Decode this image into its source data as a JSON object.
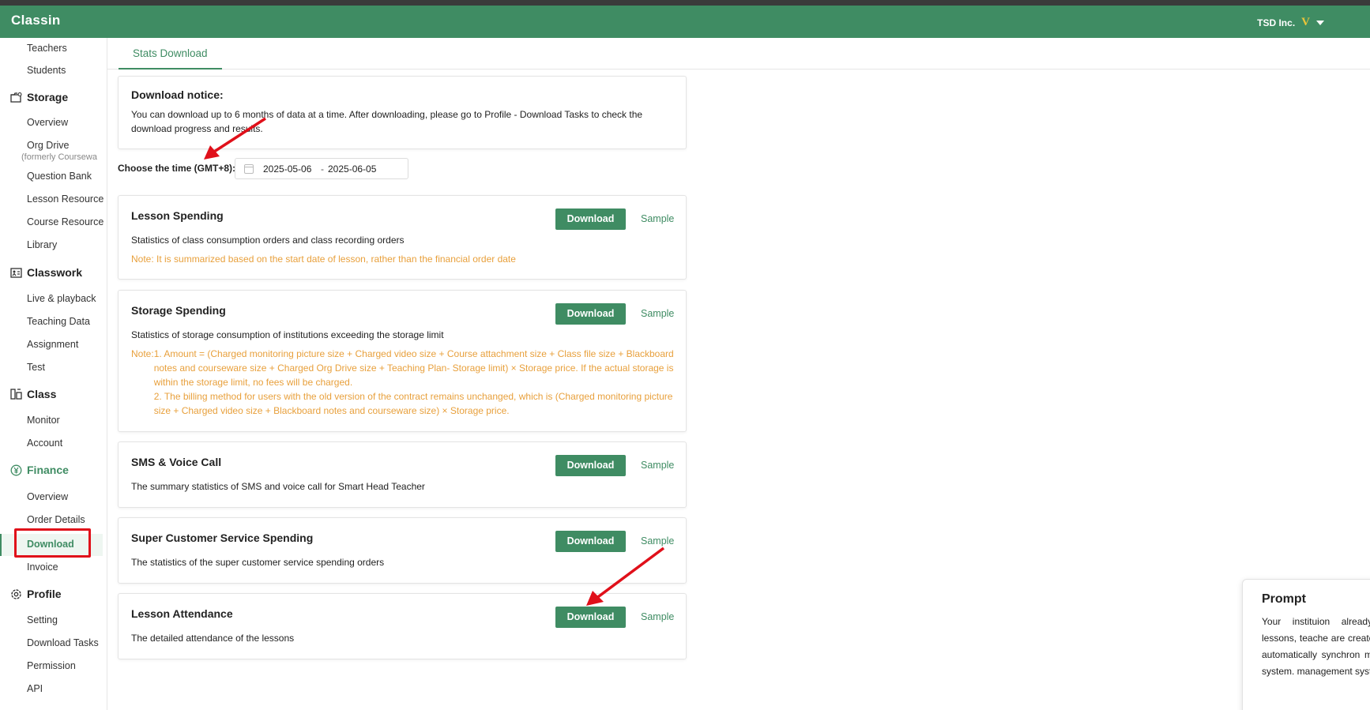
{
  "header": {
    "logo": "Classin",
    "org_name": "TSD Inc.",
    "vip_badge": "V"
  },
  "sidebar": {
    "items": {
      "teachers": "Teachers",
      "students": "Students",
      "storage_group": "Storage",
      "storage_overview": "Overview",
      "org_drive": "Org Drive",
      "org_drive_sub": "(formerly Coursewa",
      "question_bank": "Question Bank",
      "lesson_resource": "Lesson Resource",
      "course_resource": "Course Resource",
      "library": "Library",
      "classwork_group": "Classwork",
      "live_playback": "Live & playback",
      "teaching_data": "Teaching Data",
      "assignment": "Assignment",
      "test": "Test",
      "class_group": "Class",
      "monitor": "Monitor",
      "account": "Account",
      "finance_group": "Finance",
      "finance_overview": "Overview",
      "order_details": "Order Details",
      "download": "Download",
      "invoice": "Invoice",
      "profile_group": "Profile",
      "setting": "Setting",
      "download_tasks": "Download Tasks",
      "permission": "Permission",
      "api": "API"
    }
  },
  "tabs": {
    "stats_download": "Stats Download"
  },
  "notice": {
    "title": "Download notice:",
    "text": "You can download up to 6 months of data at a time. After downloading, please go to Profile - Download Tasks to check the download progress and results."
  },
  "time_filter": {
    "label": "Choose the time (GMT+8):",
    "start": "2025-05-06",
    "separator": "-",
    "end": "2025-06-05"
  },
  "buttons": {
    "download": "Download",
    "sample": "Sample"
  },
  "cards": {
    "lesson_spending": {
      "title": "Lesson Spending",
      "desc": "Statistics of class consumption orders and class recording orders",
      "note": "Note: It is summarized based on the start date of lesson, rather than the financial order date"
    },
    "storage_spending": {
      "title": "Storage Spending",
      "desc": "Statistics of storage consumption of institutions exceeding the storage limit",
      "note_prefix": "Note:",
      "note_1": "1. Amount = (Charged monitoring picture size + Charged video size + Course attachment size + Class file size + Blackboard notes and courseware size + Charged Org Drive size + Teaching Plan- Storage limit) × Storage price. If the actual storage is within the storage limit, no fees will be charged.",
      "note_2": "2. The billing method for users with the old version of the contract remains unchanged, which is (Charged monitoring picture size + Charged video size + Blackboard notes and courseware size) × Storage price."
    },
    "sms_voice": {
      "title": "SMS & Voice Call",
      "desc": "The summary statistics of SMS and voice call for Smart Head Teacher"
    },
    "super_cs": {
      "title": "Super Customer Service Spending",
      "desc": "The statistics of the super customer service spending orders"
    },
    "lesson_attendance": {
      "title": "Lesson Attendance",
      "desc": "The detailed attendance of the lessons"
    }
  },
  "prompt": {
    "title": "Prompt",
    "body": "Your instituion already courses, lessons, teache are created in the ee automatically synchron management system. management system to c"
  },
  "colors": {
    "brand": "#3f8c63",
    "note": "#e8a03c",
    "annotation": "#e0101a"
  }
}
